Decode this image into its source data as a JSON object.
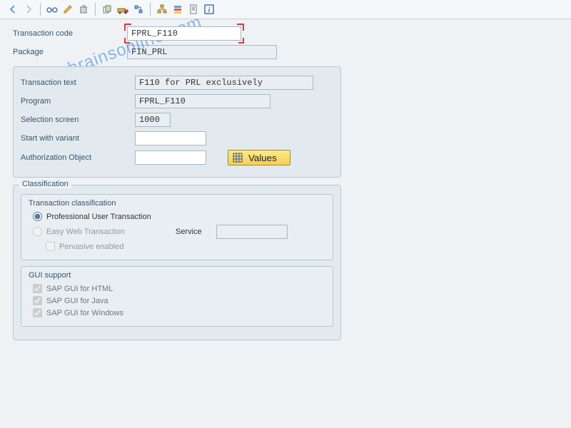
{
  "header": {
    "transaction_code_label": "Transaction code",
    "transaction_code": "FPRL_F110",
    "package_label": "Package",
    "package": "FIN_PRL"
  },
  "details": {
    "transaction_text_label": "Transaction text",
    "transaction_text": "F110 for PRL exclusively",
    "program_label": "Program",
    "program": "FPRL_F110",
    "selection_screen_label": "Selection screen",
    "selection_screen": "1000",
    "start_variant_label": "Start with variant",
    "start_variant": "",
    "auth_object_label": "Authorization Object",
    "auth_object": "",
    "values_button": "Values"
  },
  "classification": {
    "group_title": "Classification",
    "tc_title": "Transaction classification",
    "opt_prof": "Professional User Transaction",
    "opt_easy": "Easy Web Transaction",
    "service_label": "Service",
    "service": "",
    "pervasive": "Pervasive enabled",
    "gui_title": "GUI support",
    "gui_html": "SAP GUI for HTML",
    "gui_java": "SAP GUI for Java",
    "gui_win": "SAP GUI for Windows"
  },
  "watermark": "sapbrainsonline.com",
  "colors": {
    "highlight": "#d83c3c",
    "label": "#33556f",
    "button": "#f6cf55"
  }
}
